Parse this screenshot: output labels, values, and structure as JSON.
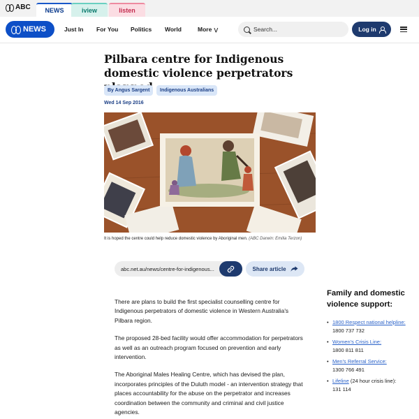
{
  "network_bar": {
    "brand": "ABC",
    "tabs": [
      "NEWS",
      "iview",
      "listen"
    ]
  },
  "header": {
    "logo_text": "NEWS",
    "nav": [
      "Just In",
      "For You",
      "Politics",
      "World",
      "More"
    ],
    "search_placeholder": "Search...",
    "login_label": "Log in"
  },
  "article": {
    "title": "Pilbara centre for Indigenous domestic violence perpetrators planned",
    "tags": [
      "By Angus Sargent",
      "Indigenous Australians"
    ],
    "date": "Wed 14 Sep 2016",
    "caption": "It is hoped the centre could help reduce domestic violence by Aboriginal men.",
    "caption_credit": "(ABC Darwin: Emilia Terzon)",
    "share_url": "abc.net.au/news/centre-for-indigenous...",
    "share_label": "Share article",
    "paragraphs": [
      "There are plans to build the first specialist counselling centre for Indigenous perpetrators of domestic violence in Western Australia's Pilbara region.",
      "The proposed 28-bed facility would offer accommodation for perpetrators as well as an outreach program focused on prevention and early intervention.",
      "The Aboriginal Males Healing Centre, which has devised the plan, incorporates principles of the Duluth model - an intervention strategy that places accountability for the abuse on the perpetrator and increases coordination between the community and criminal and civil justice agencies."
    ]
  },
  "support": {
    "heading": "Family and domestic violence support:",
    "items": [
      {
        "name": "1800 Respect national helpline:",
        "note": "",
        "number": "1800 737 732"
      },
      {
        "name": "Women's Crisis Line:",
        "note": "",
        "number": "1800 811 811"
      },
      {
        "name": "Men's Referral Service:",
        "note": "",
        "number": "1300 766 491"
      },
      {
        "name": "Lifeline",
        "note": " (24 hour crisis line):",
        "number": "131 114"
      }
    ]
  }
}
